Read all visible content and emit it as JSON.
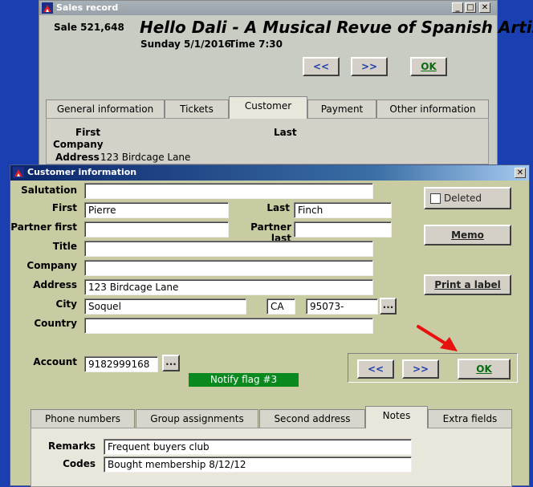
{
  "sales_window": {
    "title": "Sales record",
    "sale_label": "Sale 521,648",
    "event_title": "Hello Dali - A Musical Revue of Spanish Artists",
    "event_date": "Sunday 5/1/2016",
    "event_time": "Time 7:30",
    "prev_label": "<<",
    "next_label": ">>",
    "ok_label": "OK",
    "tabs": [
      "General information",
      "Tickets",
      "Customer",
      "Payment",
      "Other information"
    ],
    "active_tab": "Customer",
    "first_label": "First",
    "last_label": "Last",
    "company_label": "Company",
    "address_label": "Address",
    "address_value": "123 Birdcage Lane"
  },
  "customer_window": {
    "title": "Customer information",
    "labels": {
      "salutation": "Salutation",
      "first": "First",
      "last": "Last",
      "partner_first": "Partner first",
      "partner_last": "Partner last",
      "title": "Title",
      "company": "Company",
      "address": "Address",
      "city": "City",
      "country": "Country",
      "account": "Account"
    },
    "values": {
      "salutation": "",
      "first": "Pierre",
      "last": "Finch",
      "partner_first": "",
      "partner_last": "",
      "title": "",
      "company": "",
      "address": "123 Birdcage Lane",
      "city": "Soquel",
      "state": "CA",
      "zip": "95073-",
      "country": "",
      "account": "9182999168"
    },
    "ellipsis": "...",
    "deleted_label": "Deleted",
    "memo_label": "Memo",
    "print_label_label": "Print a label",
    "notify_flag": "Notify flag #3",
    "prev_label": "<<",
    "next_label": ">>",
    "ok_label": "OK",
    "tabs": [
      "Phone numbers",
      "Group assignments",
      "Second address",
      "Notes",
      "Extra fields"
    ],
    "active_tab": "Notes",
    "remarks_label": "Remarks",
    "remarks_value": "Frequent buyers club",
    "codes_label": "Codes",
    "codes_value": "Bought membership 8/12/12"
  },
  "colors": {
    "desktop": "#1a3fb0",
    "front_bg": "#c9cba2",
    "back_bg": "#c8ccc2",
    "notify_flag_bg": "#0a8a1e",
    "annotation_arrow": "#e81010",
    "nav_arrow_text": "#1f3ea8",
    "ok_text": "#0a6a10"
  },
  "icons": [
    "app-icon",
    "minimize-icon",
    "maximize-icon",
    "close-icon",
    "red-arrow-annotation"
  ]
}
